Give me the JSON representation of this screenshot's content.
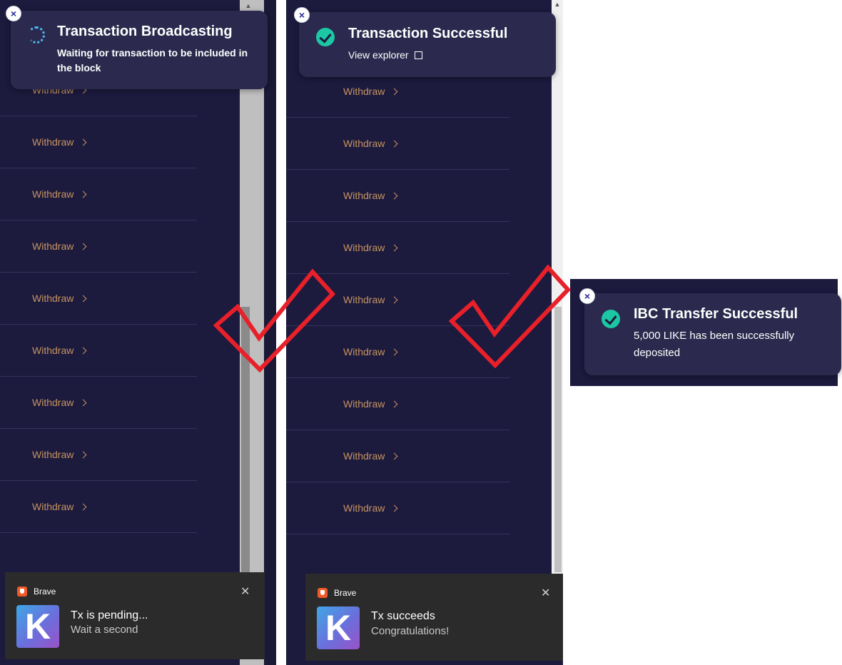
{
  "rows": {
    "label": "Withdraw"
  },
  "panel1": {
    "toast": {
      "title": "Transaction Broadcasting",
      "body": "Waiting for transaction to be included in the block",
      "close": "×"
    },
    "notification": {
      "app": "Brave",
      "title": "Tx is pending...",
      "body": "Wait a second",
      "logo_letter": "K",
      "close": "✕"
    }
  },
  "panel2": {
    "toast": {
      "title": "Transaction Successful",
      "link": "View explorer",
      "close": "×"
    },
    "notification": {
      "app": "Brave",
      "title": "Tx succeeds",
      "body": "Congratulations!",
      "logo_letter": "K",
      "close": "✕"
    }
  },
  "panel3": {
    "toast": {
      "title": "IBC Transfer Successful",
      "body": "5,000 LIKE has been successfully deposited",
      "close": "×"
    }
  },
  "colors": {
    "background": "#1c1a3d",
    "toast": "#2b2a4e",
    "withdraw_link": "#c69462",
    "success": "#1dc7a4",
    "spinner": "#4fb9f0",
    "annotation_check": "#e8202a",
    "notification": "#2b2b2b"
  },
  "icons": {
    "spinner": "loading-spinner-icon",
    "success": "check-circle-icon",
    "external": "external-link-icon",
    "close": "close-icon",
    "chevron": "chevron-right-icon",
    "annotation": "red-checkmark-icon",
    "brave": "brave-icon",
    "app_logo": "k-app-logo"
  }
}
